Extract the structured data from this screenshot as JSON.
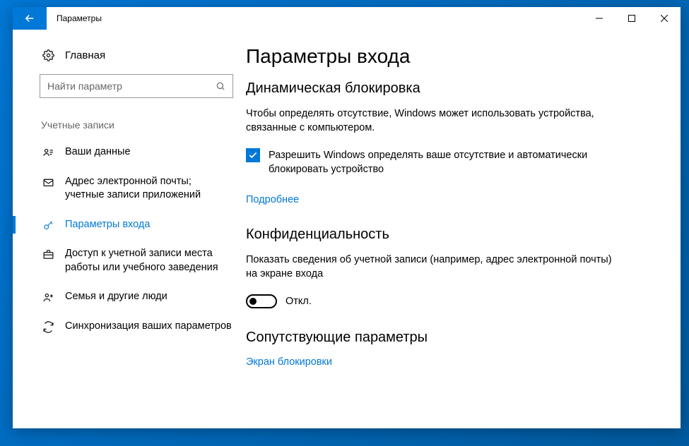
{
  "titlebar": {
    "title": "Параметры"
  },
  "sidebar": {
    "home": "Главная",
    "search_placeholder": "Найти параметр",
    "section": "Учетные записи",
    "items": [
      {
        "label": "Ваши данные"
      },
      {
        "label": "Адрес электронной почты; учетные записи приложений"
      },
      {
        "label": "Параметры входа"
      },
      {
        "label": "Доступ к учетной записи места работы или учебного заведения"
      },
      {
        "label": "Семья и другие люди"
      },
      {
        "label": "Синхронизация ваших параметров"
      }
    ]
  },
  "main": {
    "title": "Параметры входа",
    "dynlock": {
      "heading": "Динамическая блокировка",
      "desc": "Чтобы определять отсутствие, Windows может использовать устройства, связанные с компьютером.",
      "checkbox": "Разрешить Windows определять ваше отсутствие и автоматически блокировать устройство",
      "more": "Подробнее"
    },
    "privacy": {
      "heading": "Конфиденциальность",
      "desc": "Показать сведения об учетной записи (например, адрес электронной почты) на экране входа",
      "toggle_state": "Откл."
    },
    "related": {
      "heading": "Сопутствующие параметры",
      "link": "Экран блокировки"
    }
  }
}
